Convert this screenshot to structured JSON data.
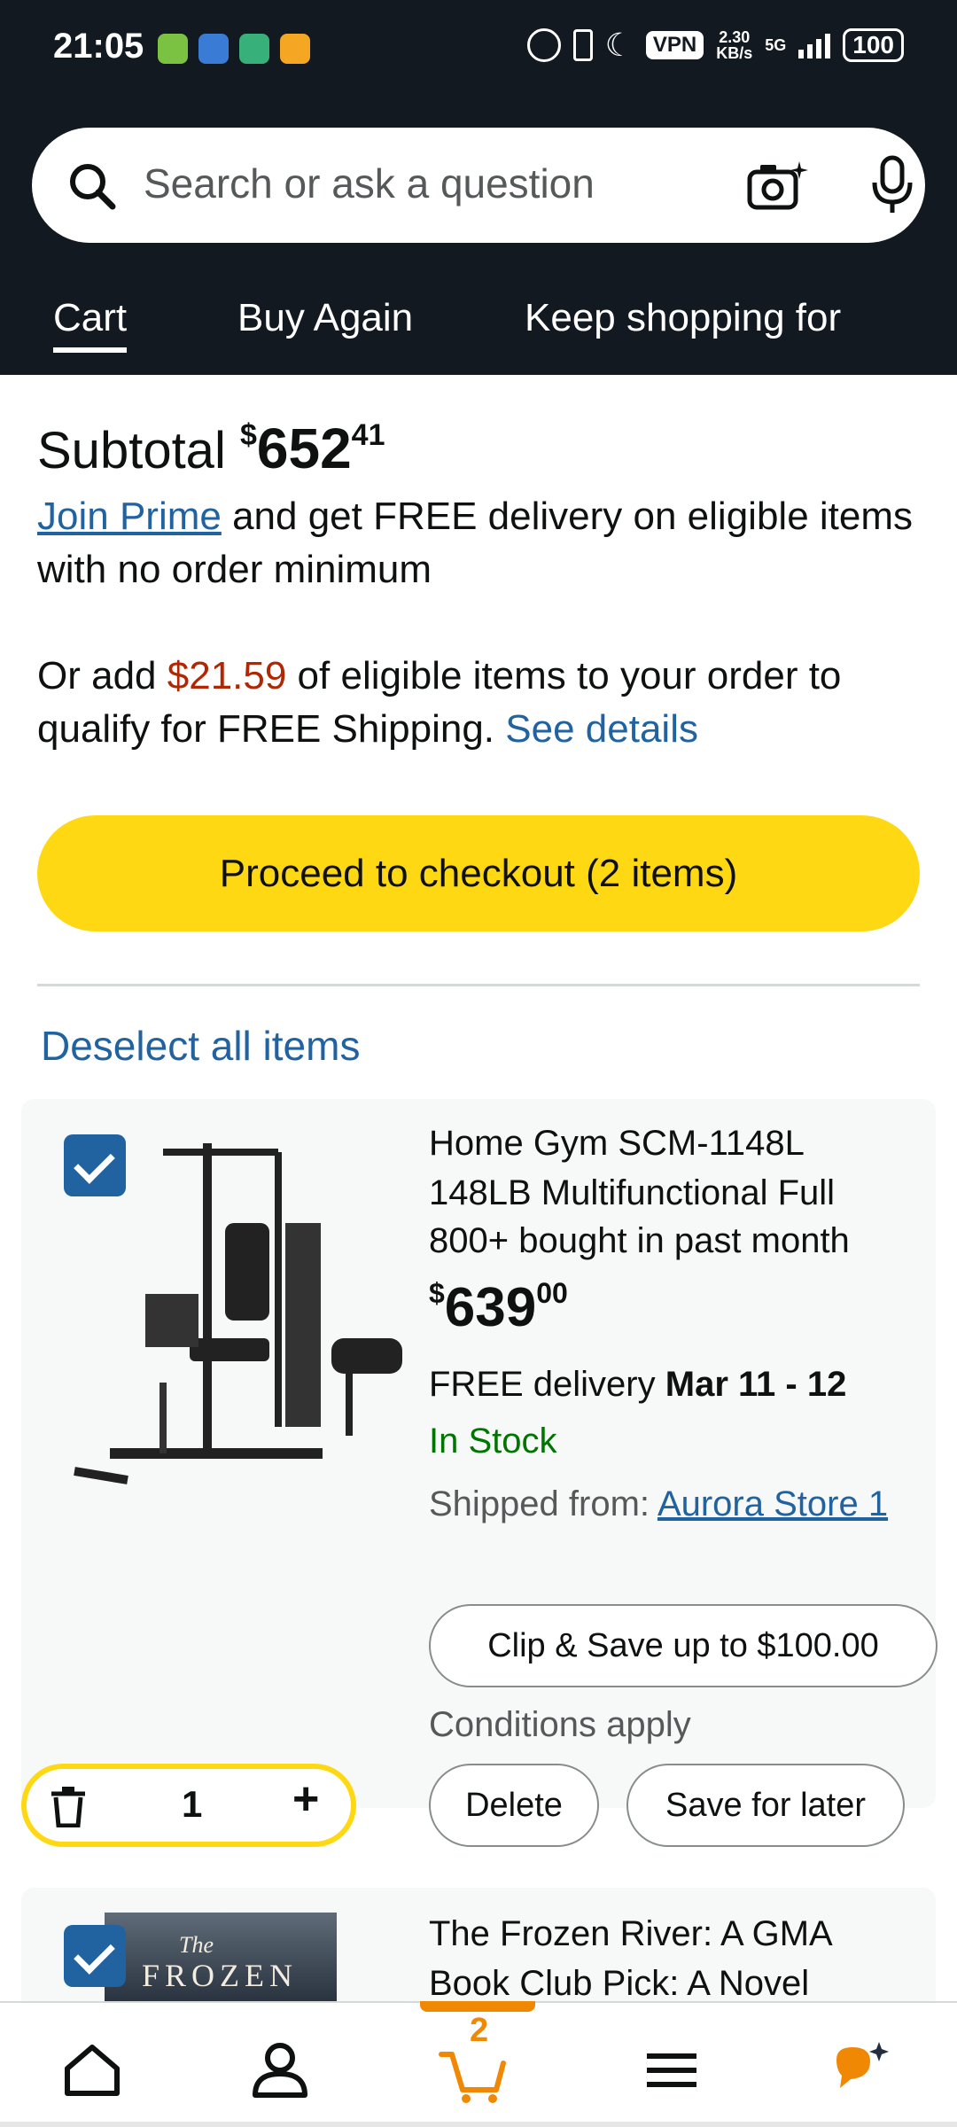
{
  "status_bar": {
    "time": "21:05",
    "vpn": "VPN",
    "speed_value": "2.30",
    "speed_unit": "KB/s",
    "network": "5G",
    "battery": "100"
  },
  "search": {
    "placeholder": "Search or ask a question"
  },
  "tabs": [
    {
      "label": "Cart",
      "active": true
    },
    {
      "label": "Buy Again",
      "active": false
    },
    {
      "label": "Keep shopping for",
      "active": false
    }
  ],
  "subtotal": {
    "label": "Subtotal",
    "currency": "$",
    "whole": "652",
    "fraction": "41"
  },
  "prime": {
    "link": "Join Prime",
    "text": " and get FREE delivery on eligible items with no order minimum"
  },
  "free_shipping": {
    "prefix": "Or add ",
    "amount": "$21.59",
    "suffix": " of eligible items to your order to qualify for FREE Shipping. ",
    "details_link": "See details"
  },
  "checkout_button": "Proceed to checkout (2 items)",
  "deselect_link": "Deselect all items",
  "items": [
    {
      "title": "Home Gym SCM-1148L 148LB Multifunctional Full",
      "bought": "800+ bought in past month",
      "price_currency": "$",
      "price_whole": "639",
      "price_fraction": "00",
      "delivery_prefix": "FREE delivery ",
      "delivery_dates": "Mar 11 - 12",
      "stock": "In Stock",
      "shipped_label": "Shipped from: ",
      "store": "Aurora Store 1",
      "coupon": "Clip & Save up to $100.00",
      "conditions": "Conditions apply",
      "quantity": "1",
      "delete_label": "Delete",
      "save_later_label": "Save for later",
      "selected": true
    },
    {
      "title": "The Frozen River: A GMA Book Club Pick: A Novel",
      "cover_subtitle": "The",
      "cover_title": "FROZEN",
      "selected": true
    }
  ],
  "bottom_nav": {
    "cart_count": "2",
    "items": [
      "home-icon",
      "account-icon",
      "cart-icon",
      "menu-icon",
      "rufus-icon"
    ]
  },
  "colors": {
    "header_bg": "#131921",
    "checkout_yellow": "#ffd814",
    "link_blue": "#2162a1",
    "price_red": "#b12704",
    "stock_green": "#007600",
    "accent_orange": "#f08804"
  }
}
